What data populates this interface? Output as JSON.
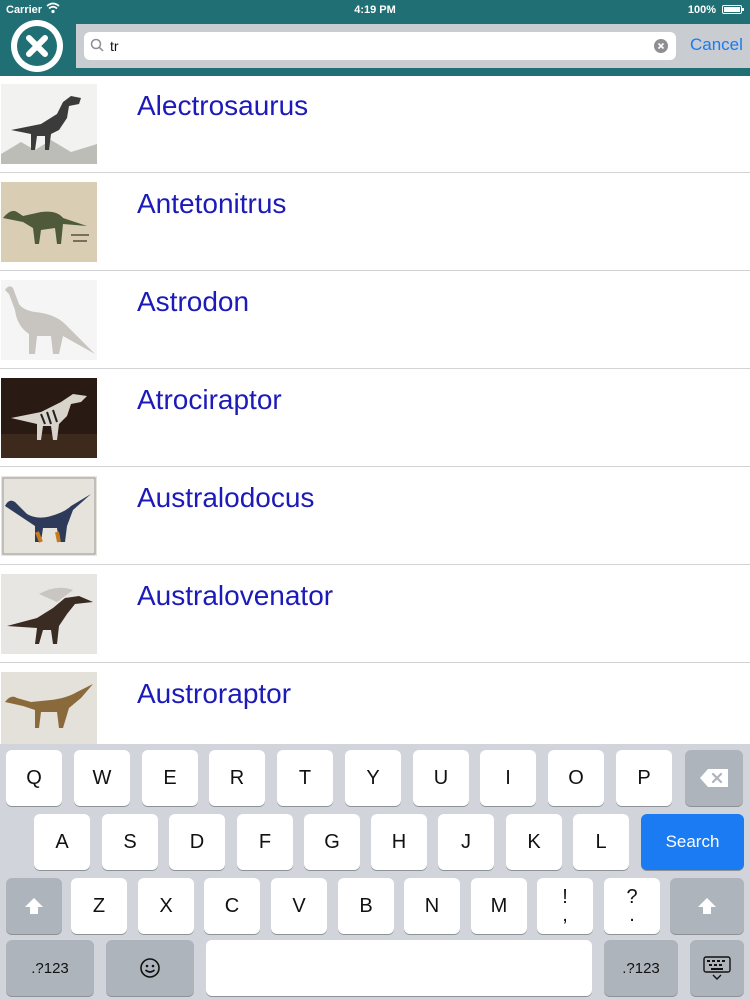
{
  "status_bar": {
    "carrier": "Carrier",
    "time": "4:19 PM",
    "battery": "100%"
  },
  "search": {
    "value": "tr",
    "cancel_label": "Cancel"
  },
  "results": [
    {
      "name": "Alectrosaurus",
      "icon": "dinosaur-illustration"
    },
    {
      "name": "Antetonitrus",
      "icon": "dinosaur-illustration"
    },
    {
      "name": "Astrodon",
      "icon": "dinosaur-illustration"
    },
    {
      "name": "Atrociraptor",
      "icon": "dinosaur-illustration"
    },
    {
      "name": "Australodocus",
      "icon": "dinosaur-illustration"
    },
    {
      "name": "Australovenator",
      "icon": "dinosaur-illustration"
    },
    {
      "name": "Austroraptor",
      "icon": "dinosaur-illustration"
    }
  ],
  "keyboard": {
    "row1": [
      "Q",
      "W",
      "E",
      "R",
      "T",
      "Y",
      "U",
      "I",
      "O",
      "P"
    ],
    "row2": [
      "A",
      "S",
      "D",
      "F",
      "G",
      "H",
      "J",
      "K",
      "L"
    ],
    "row3": [
      "Z",
      "X",
      "C",
      "V",
      "B",
      "N",
      "M"
    ],
    "punct1": {
      "top": "!",
      "bottom": ","
    },
    "punct2": {
      "top": "?",
      "bottom": "."
    },
    "search_label": "Search",
    "numbers_label": ".?123",
    "numbers_label_right": ".?123"
  },
  "colors": {
    "header": "#1f6f74",
    "link": "#1a7bf2",
    "result_text": "#1c1ab8",
    "keyboard_bg": "#d1d5db"
  }
}
